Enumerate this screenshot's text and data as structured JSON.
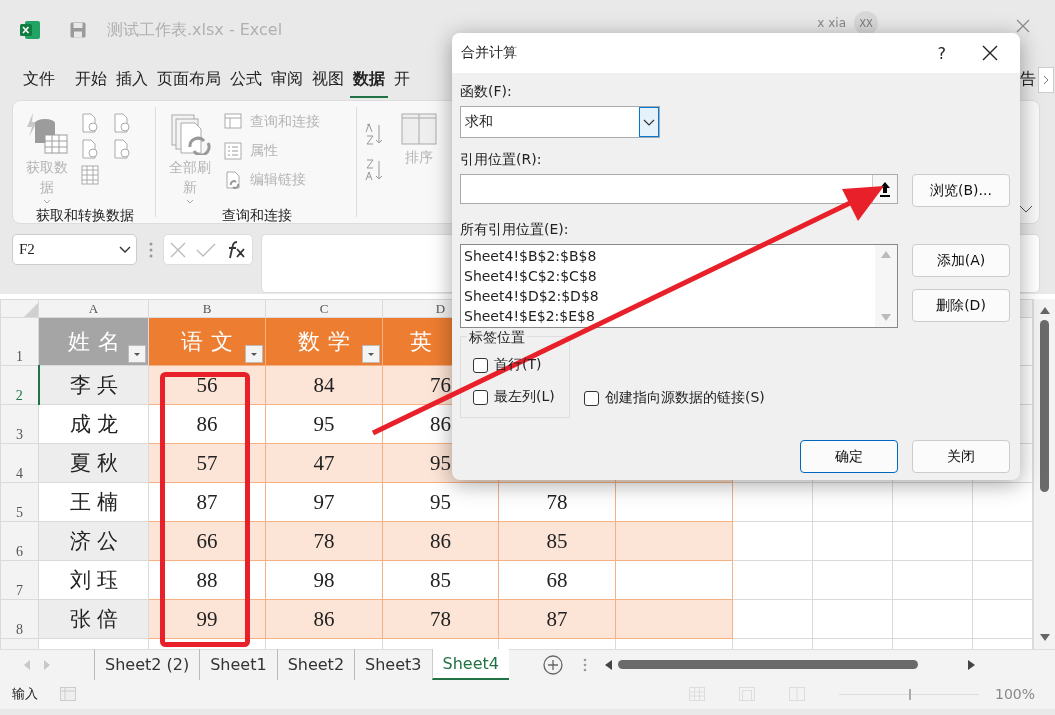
{
  "window": {
    "title": "测试工作表.xlsx  -  Excel",
    "user": "x xia",
    "avatar": "XX"
  },
  "menu_tabs": [
    {
      "label": "文件",
      "selected": false
    },
    {
      "label": "开始",
      "selected": false
    },
    {
      "label": "插入",
      "selected": false
    },
    {
      "label": "页面布局",
      "selected": false
    },
    {
      "label": "公式",
      "selected": false
    },
    {
      "label": "审阅",
      "selected": false
    },
    {
      "label": "视图",
      "selected": false
    },
    {
      "label": "数据",
      "selected": true
    },
    {
      "label": "开",
      "selected": false
    }
  ],
  "menu_tab_right": "告",
  "ribbon": {
    "groups": [
      {
        "label": "获取和转换数据",
        "large_button": {
          "label": "获取数据",
          "disabled": true
        }
      },
      {
        "label": "查询和连接",
        "large_button": {
          "label": "全部刷新",
          "disabled": true
        },
        "small_buttons": [
          {
            "label": "查询和连接",
            "disabled": true
          },
          {
            "label": "属性",
            "disabled": true
          },
          {
            "label": "编辑链接",
            "disabled": true
          }
        ]
      },
      {
        "large_button": {
          "label": "排序",
          "disabled": true
        }
      }
    ]
  },
  "formula_bar": {
    "name_box": "F2"
  },
  "sheet": {
    "columns": [
      "A",
      "B",
      "C",
      "D"
    ],
    "header_row": {
      "number": "1",
      "cells": [
        {
          "text": "姓名",
          "filter_button": true
        },
        {
          "text": "语文",
          "filter_button": true
        },
        {
          "text": "数学",
          "filter_button": true
        },
        {
          "text": "英",
          "filter_button": false
        }
      ]
    },
    "rows": [
      {
        "number": "2",
        "selected": true,
        "cells": [
          "李兵",
          "56",
          "84",
          "76"
        ]
      },
      {
        "number": "3",
        "selected": false,
        "cells": [
          "成龙",
          "86",
          "95",
          "86"
        ]
      },
      {
        "number": "4",
        "selected": false,
        "cells": [
          "夏秋",
          "57",
          "47",
          "95"
        ]
      },
      {
        "number": "5",
        "selected": false,
        "cells": [
          "王楠",
          "87",
          "97",
          "95",
          "78"
        ]
      },
      {
        "number": "6",
        "selected": false,
        "cells": [
          "济公",
          "66",
          "78",
          "86",
          "85"
        ]
      },
      {
        "number": "7",
        "selected": false,
        "cells": [
          "刘珏",
          "88",
          "98",
          "85",
          "68"
        ]
      },
      {
        "number": "8",
        "selected": false,
        "cells": [
          "张倍",
          "99",
          "86",
          "78",
          "87"
        ]
      }
    ]
  },
  "sheet_tabs": [
    {
      "label": "Sheet2 (2)",
      "selected": false
    },
    {
      "label": "Sheet1",
      "selected": false
    },
    {
      "label": "Sheet2",
      "selected": false
    },
    {
      "label": "Sheet3",
      "selected": false
    },
    {
      "label": "Sheet4",
      "selected": true
    }
  ],
  "status_bar": {
    "mode": "输入",
    "zoom_slider": {
      "level": 0.5
    },
    "zoom": "100%"
  },
  "dialog": {
    "title": "合并计算",
    "help": "?",
    "function_label": "函数(F):",
    "function_value": "求和",
    "reference_label": "引用位置(R):",
    "browse_button": "浏览(B)...",
    "all_references_label": "所有引用位置(E):",
    "all_references": [
      "Sheet4!$B$2:$B$8",
      "Sheet4!$C$2:$C$8",
      "Sheet4!$D$2:$D$8",
      "Sheet4!$E$2:$E$8"
    ],
    "add_button": "添加(A)",
    "delete_button": "删除(D)",
    "label_group": "标签位置",
    "checkboxes": [
      {
        "label": "首行(T)",
        "checked": false
      },
      {
        "label": "最左列(L)",
        "checked": false
      },
      {
        "label": "创建指向源数据的链接(S)",
        "checked": false
      }
    ],
    "ok_button": "确定",
    "close_button": "关闭"
  }
}
